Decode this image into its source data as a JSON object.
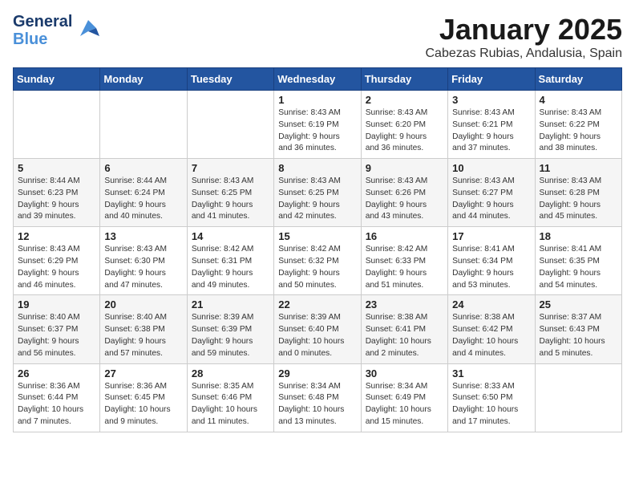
{
  "logo": {
    "general": "General",
    "blue": "Blue",
    "bird": "▶"
  },
  "title": "January 2025",
  "subtitle": "Cabezas Rubias, Andalusia, Spain",
  "weekdays": [
    "Sunday",
    "Monday",
    "Tuesday",
    "Wednesday",
    "Thursday",
    "Friday",
    "Saturday"
  ],
  "weeks": [
    [
      {
        "day": "",
        "info": ""
      },
      {
        "day": "",
        "info": ""
      },
      {
        "day": "",
        "info": ""
      },
      {
        "day": "1",
        "info": "Sunrise: 8:43 AM\nSunset: 6:19 PM\nDaylight: 9 hours\nand 36 minutes."
      },
      {
        "day": "2",
        "info": "Sunrise: 8:43 AM\nSunset: 6:20 PM\nDaylight: 9 hours\nand 36 minutes."
      },
      {
        "day": "3",
        "info": "Sunrise: 8:43 AM\nSunset: 6:21 PM\nDaylight: 9 hours\nand 37 minutes."
      },
      {
        "day": "4",
        "info": "Sunrise: 8:43 AM\nSunset: 6:22 PM\nDaylight: 9 hours\nand 38 minutes."
      }
    ],
    [
      {
        "day": "5",
        "info": "Sunrise: 8:44 AM\nSunset: 6:23 PM\nDaylight: 9 hours\nand 39 minutes."
      },
      {
        "day": "6",
        "info": "Sunrise: 8:44 AM\nSunset: 6:24 PM\nDaylight: 9 hours\nand 40 minutes."
      },
      {
        "day": "7",
        "info": "Sunrise: 8:43 AM\nSunset: 6:25 PM\nDaylight: 9 hours\nand 41 minutes."
      },
      {
        "day": "8",
        "info": "Sunrise: 8:43 AM\nSunset: 6:25 PM\nDaylight: 9 hours\nand 42 minutes."
      },
      {
        "day": "9",
        "info": "Sunrise: 8:43 AM\nSunset: 6:26 PM\nDaylight: 9 hours\nand 43 minutes."
      },
      {
        "day": "10",
        "info": "Sunrise: 8:43 AM\nSunset: 6:27 PM\nDaylight: 9 hours\nand 44 minutes."
      },
      {
        "day": "11",
        "info": "Sunrise: 8:43 AM\nSunset: 6:28 PM\nDaylight: 9 hours\nand 45 minutes."
      }
    ],
    [
      {
        "day": "12",
        "info": "Sunrise: 8:43 AM\nSunset: 6:29 PM\nDaylight: 9 hours\nand 46 minutes."
      },
      {
        "day": "13",
        "info": "Sunrise: 8:43 AM\nSunset: 6:30 PM\nDaylight: 9 hours\nand 47 minutes."
      },
      {
        "day": "14",
        "info": "Sunrise: 8:42 AM\nSunset: 6:31 PM\nDaylight: 9 hours\nand 49 minutes."
      },
      {
        "day": "15",
        "info": "Sunrise: 8:42 AM\nSunset: 6:32 PM\nDaylight: 9 hours\nand 50 minutes."
      },
      {
        "day": "16",
        "info": "Sunrise: 8:42 AM\nSunset: 6:33 PM\nDaylight: 9 hours\nand 51 minutes."
      },
      {
        "day": "17",
        "info": "Sunrise: 8:41 AM\nSunset: 6:34 PM\nDaylight: 9 hours\nand 53 minutes."
      },
      {
        "day": "18",
        "info": "Sunrise: 8:41 AM\nSunset: 6:35 PM\nDaylight: 9 hours\nand 54 minutes."
      }
    ],
    [
      {
        "day": "19",
        "info": "Sunrise: 8:40 AM\nSunset: 6:37 PM\nDaylight: 9 hours\nand 56 minutes."
      },
      {
        "day": "20",
        "info": "Sunrise: 8:40 AM\nSunset: 6:38 PM\nDaylight: 9 hours\nand 57 minutes."
      },
      {
        "day": "21",
        "info": "Sunrise: 8:39 AM\nSunset: 6:39 PM\nDaylight: 9 hours\nand 59 minutes."
      },
      {
        "day": "22",
        "info": "Sunrise: 8:39 AM\nSunset: 6:40 PM\nDaylight: 10 hours\nand 0 minutes."
      },
      {
        "day": "23",
        "info": "Sunrise: 8:38 AM\nSunset: 6:41 PM\nDaylight: 10 hours\nand 2 minutes."
      },
      {
        "day": "24",
        "info": "Sunrise: 8:38 AM\nSunset: 6:42 PM\nDaylight: 10 hours\nand 4 minutes."
      },
      {
        "day": "25",
        "info": "Sunrise: 8:37 AM\nSunset: 6:43 PM\nDaylight: 10 hours\nand 5 minutes."
      }
    ],
    [
      {
        "day": "26",
        "info": "Sunrise: 8:36 AM\nSunset: 6:44 PM\nDaylight: 10 hours\nand 7 minutes."
      },
      {
        "day": "27",
        "info": "Sunrise: 8:36 AM\nSunset: 6:45 PM\nDaylight: 10 hours\nand 9 minutes."
      },
      {
        "day": "28",
        "info": "Sunrise: 8:35 AM\nSunset: 6:46 PM\nDaylight: 10 hours\nand 11 minutes."
      },
      {
        "day": "29",
        "info": "Sunrise: 8:34 AM\nSunset: 6:48 PM\nDaylight: 10 hours\nand 13 minutes."
      },
      {
        "day": "30",
        "info": "Sunrise: 8:34 AM\nSunset: 6:49 PM\nDaylight: 10 hours\nand 15 minutes."
      },
      {
        "day": "31",
        "info": "Sunrise: 8:33 AM\nSunset: 6:50 PM\nDaylight: 10 hours\nand 17 minutes."
      },
      {
        "day": "",
        "info": ""
      }
    ]
  ]
}
